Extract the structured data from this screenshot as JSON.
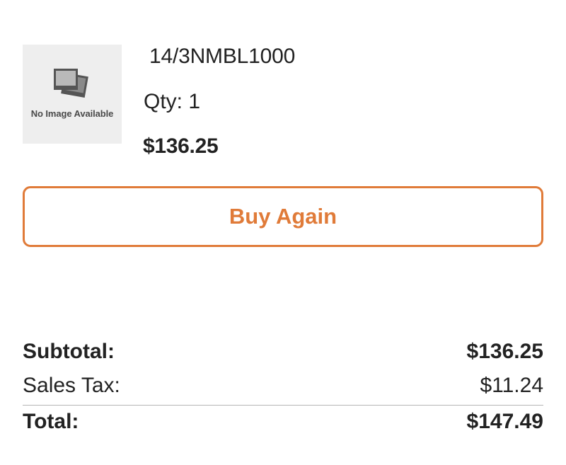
{
  "product": {
    "image_placeholder_text": "No Image Available",
    "image_icon": "photo-stack-icon",
    "name": "14/3NMBL1000",
    "quantity": "Qty: 1",
    "price": "$136.25"
  },
  "actions": {
    "buy_again_label": "Buy Again"
  },
  "summary": {
    "subtotal_label": "Subtotal:",
    "subtotal_value": "$136.25",
    "tax_label": "Sales Tax:",
    "tax_value": "$11.24",
    "total_label": "Total:",
    "total_value": "$147.49"
  },
  "colors": {
    "accent": "#e07b39",
    "text": "#222222",
    "placeholder_bg": "#eeeeee",
    "divider": "#b5b5b5"
  }
}
